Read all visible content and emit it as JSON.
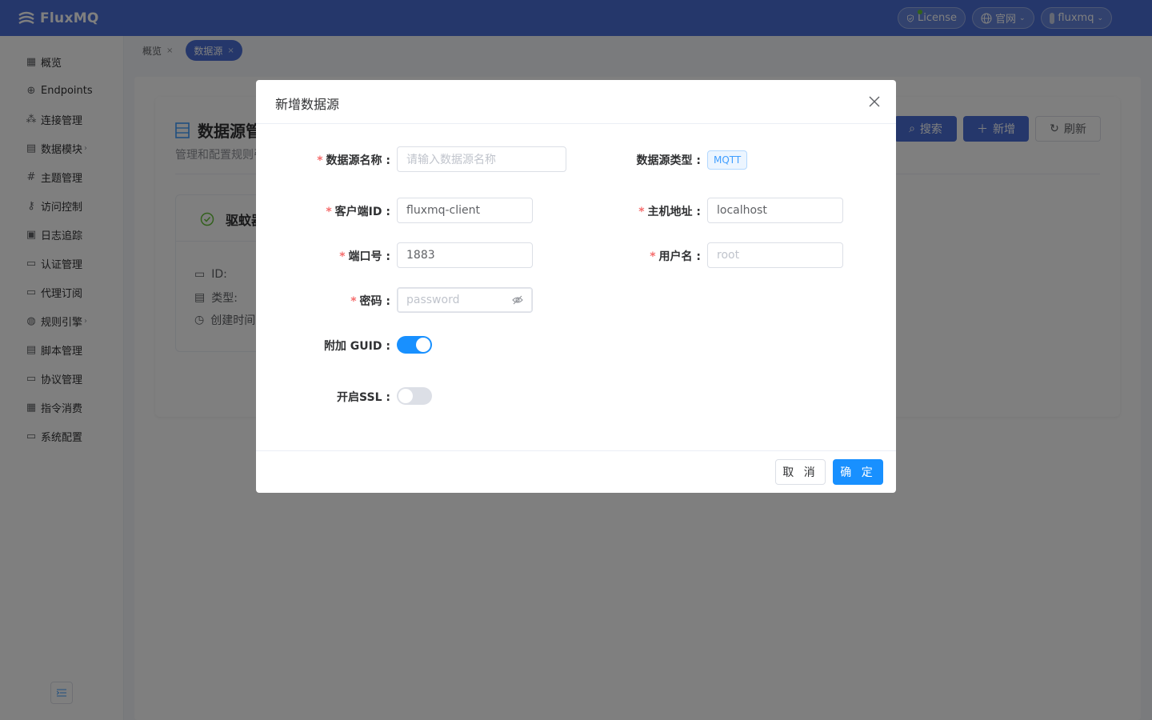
{
  "app": {
    "name": "FluxMQ"
  },
  "header": {
    "license_label": "License",
    "website_label": "官网",
    "user_label": "fluxmq"
  },
  "sidebar": {
    "items": [
      {
        "label": "概览",
        "icon": "dashboard-icon"
      },
      {
        "label": "Endpoints",
        "icon": "globe-icon"
      },
      {
        "label": "连接管理",
        "icon": "connection-icon"
      },
      {
        "label": "数据模块",
        "icon": "data-icon",
        "has_arrow": true
      },
      {
        "label": "主题管理",
        "icon": "hash-icon"
      },
      {
        "label": "访问控制",
        "icon": "key-icon"
      },
      {
        "label": "日志追踪",
        "icon": "log-icon"
      },
      {
        "label": "认证管理",
        "icon": "auth-icon"
      },
      {
        "label": "代理订阅",
        "icon": "subscribe-icon"
      },
      {
        "label": "规则引擎",
        "icon": "rule-icon",
        "has_arrow": true
      },
      {
        "label": "脚本管理",
        "icon": "script-icon"
      },
      {
        "label": "协议管理",
        "icon": "protocol-icon"
      },
      {
        "label": "指令消费",
        "icon": "command-icon"
      },
      {
        "label": "系统配置",
        "icon": "settings-icon"
      }
    ]
  },
  "tabs": [
    {
      "label": "概览",
      "active": false
    },
    {
      "label": "数据源",
      "active": true
    }
  ],
  "page": {
    "title": "数据源管",
    "subtitle": "管理和配置规则引",
    "search_label": "搜索",
    "add_label": "新增",
    "refresh_label": "刷新",
    "card_title": "驱蚊器",
    "row_id": "ID:",
    "row_type": "类型:",
    "row_created": "创建时间"
  },
  "dialog": {
    "title": "新增数据源",
    "fields": {
      "name": {
        "label": "数据源名称",
        "required": true,
        "placeholder": "请输入数据源名称",
        "value": ""
      },
      "type": {
        "label": "数据源类型",
        "required": false,
        "value": "MQTT"
      },
      "client_id": {
        "label": "客户端ID",
        "required": true,
        "value": "fluxmq-client"
      },
      "host": {
        "label": "主机地址",
        "required": true,
        "value": "localhost"
      },
      "port": {
        "label": "端口号",
        "required": true,
        "value": "1883"
      },
      "username": {
        "label": "用户名",
        "required": true,
        "placeholder": "root",
        "value": ""
      },
      "password": {
        "label": "密码",
        "required": true,
        "placeholder": "password",
        "value": ""
      },
      "guid": {
        "label": "附加 GUID",
        "on": true
      },
      "ssl": {
        "label": "开启SSL",
        "on": false
      }
    },
    "cancel_label": "取 消",
    "ok_label": "确 定"
  },
  "colors": {
    "header": "#4a6fd6",
    "primary": "#1890ff",
    "required": "#f56c6c"
  }
}
